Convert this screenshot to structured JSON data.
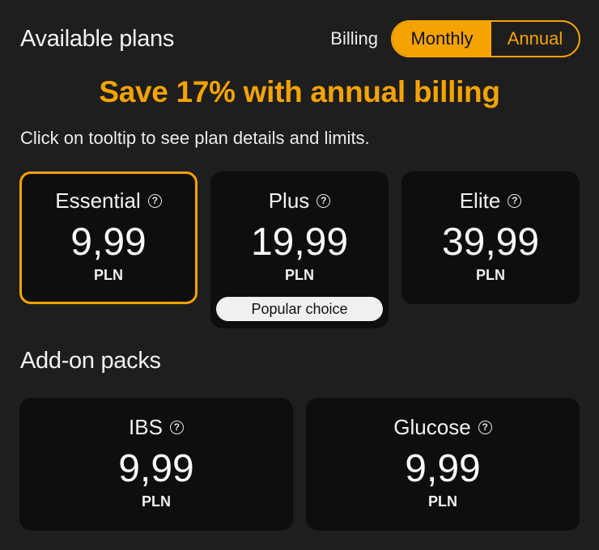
{
  "header": {
    "title": "Available plans",
    "billing_label": "Billing",
    "options": [
      "Monthly",
      "Annual"
    ],
    "selected": "Monthly"
  },
  "promo": "Save 17% with annual billing",
  "subtitle": "Click on tooltip to see plan details and limits.",
  "plans": [
    {
      "name": "Essential",
      "price": "9,99",
      "currency": "PLN",
      "selected": true
    },
    {
      "name": "Plus",
      "price": "19,99",
      "currency": "PLN",
      "badge": "Popular choice"
    },
    {
      "name": "Elite",
      "price": "39,99",
      "currency": "PLN"
    }
  ],
  "addons_title": "Add-on packs",
  "addons": [
    {
      "name": "IBS",
      "price": "9,99",
      "currency": "PLN"
    },
    {
      "name": "Glucose",
      "price": "9,99",
      "currency": "PLN"
    }
  ],
  "colors": {
    "accent": "#f5a300",
    "background": "#1e1e1e",
    "card": "#0e0e0e"
  },
  "icons": {
    "help": "question-circle-icon"
  }
}
